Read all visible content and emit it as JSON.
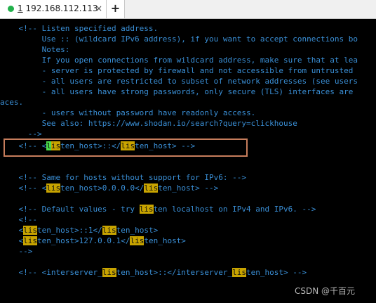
{
  "tab": {
    "number": "1",
    "host": "192.168.112.113",
    "close": "×",
    "new": "+"
  },
  "terminal": {
    "line00": "    <!-- Listen specified address.",
    "line01": "         Use :: (wildcard IPv6 address), if you want to accept connections bo",
    "line02": "         Notes:",
    "line03": "         If you open connections from wildcard address, make sure that at lea",
    "line04": "         - server is protected by firewall and not accessible from untrusted",
    "line05": "         - all users are restricted to subset of network addresses (see users",
    "line06": "         - all users have strong passwords, only secure (TLS) interfaces are",
    "line07": "aces.",
    "line08": "         - users without password have readonly access.",
    "line09": "         See also: https://www.shodan.io/search?query=clickhouse",
    "line10": "      -->",
    "line11": {
      "a": "    <!-- <",
      "cur": "l",
      "hl": "is",
      "b": "ten_host>::</",
      "hl2": "lis",
      "c": "ten_host> -->"
    },
    "line14": {
      "a": "    <!-- Same for hosts without support for IPv6: -->"
    },
    "line15": {
      "a": "    <!-- <",
      "hl": "lis",
      "b": "ten_host>0.0.0.0</",
      "hl2": "lis",
      "c": "ten_host> -->"
    },
    "line17": {
      "a": "    <!-- Default values - try ",
      "hl": "lis",
      "b": "ten localhost on IPv4 and IPv6. -->"
    },
    "line18": "    <!--",
    "line19": {
      "a": "    <",
      "hl": "lis",
      "b": "ten_host>::1</",
      "hl2": "lis",
      "c": "ten_host>"
    },
    "line20": {
      "a": "    <",
      "hl": "lis",
      "b": "ten_host>127.0.0.1</",
      "hl2": "lis",
      "c": "ten_host>"
    },
    "line21": "    -->",
    "line23": {
      "a": "    <!-- <interserver_",
      "hl": "lis",
      "b": "ten_host>::</interserver_",
      "hl2": "lis",
      "c": "ten_host> -->"
    }
  },
  "watermark": "CSDN @千百元"
}
